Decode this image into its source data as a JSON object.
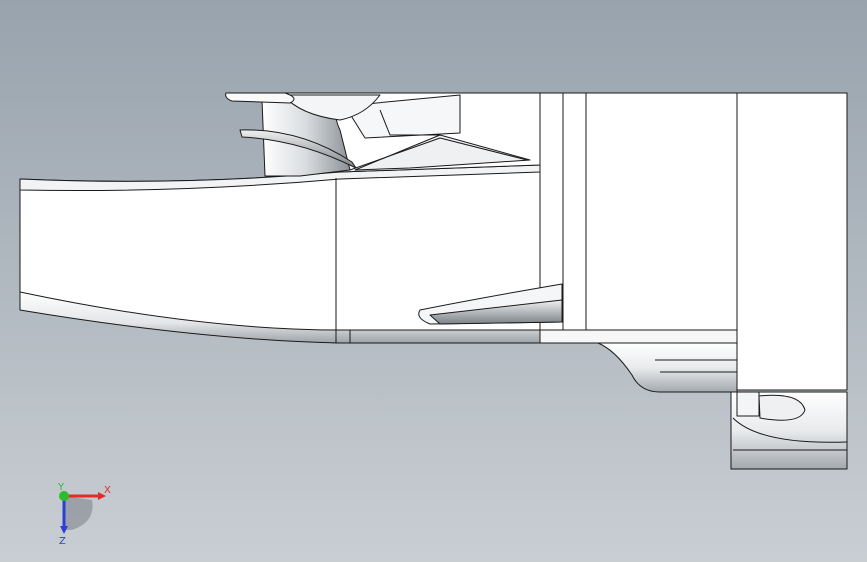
{
  "viewport": {
    "background_top": "#9aa4ae",
    "background_bottom": "#c7ccd2",
    "edge_color": "#1a1a1a",
    "face_color": "#ffffff"
  },
  "triad": {
    "x_label": "X",
    "y_label": "Y",
    "z_label": "Z",
    "x_color": "#e32b2b",
    "y_color": "#2bbd2b",
    "z_color": "#2b3fd9"
  }
}
